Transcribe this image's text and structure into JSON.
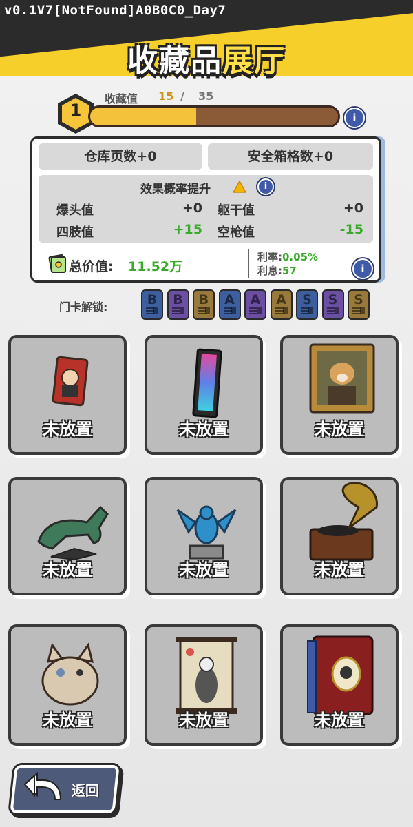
{
  "version": "v0.1V7[NotFound]A0B0C0_Day7",
  "title_part1": "收藏品",
  "title_part2": "展厅",
  "collection": {
    "level": "1",
    "label": "收藏值",
    "current": "15",
    "separator": "/",
    "max": "35",
    "progress_fraction": 0.4286
  },
  "card": {
    "warehouse_pages": "仓库页数+0",
    "safe_slots": "安全箱格数+0",
    "effect_title": "效果概率提升",
    "stats": [
      {
        "label": "爆头值",
        "value": "+0",
        "color": "#333333"
      },
      {
        "label": "躯干值",
        "value": "+0",
        "color": "#333333"
      },
      {
        "label": "四肢值",
        "value": "+15",
        "color": "#3aaa2b"
      },
      {
        "label": "空枪值",
        "value": "-15",
        "color": "#3aaa2b"
      }
    ],
    "total_label": "总价值:",
    "total_value": "11.52万",
    "rate_label": "利率:",
    "rate_value": "0.05%",
    "interest_label": "利息:",
    "interest_value": "57"
  },
  "unlock_label": "门卡解锁:",
  "keycards": [
    {
      "letter": "B",
      "color": "#3d5f9e"
    },
    {
      "letter": "B",
      "color": "#6a4fa3"
    },
    {
      "letter": "B",
      "color": "#9a7a3b"
    },
    {
      "letter": "A",
      "color": "#3d5f9e"
    },
    {
      "letter": "A",
      "color": "#6a4fa3"
    },
    {
      "letter": "A",
      "color": "#9a7a3b"
    },
    {
      "letter": "S",
      "color": "#3d5f9e"
    },
    {
      "letter": "S",
      "color": "#6a4fa3"
    },
    {
      "letter": "S",
      "color": "#9a7a3b"
    }
  ],
  "slots": [
    {
      "label": "未放置",
      "item": "playing-card-icon"
    },
    {
      "label": "未放置",
      "item": "memory-stick-icon"
    },
    {
      "label": "未放置",
      "item": "dog-portrait-icon"
    },
    {
      "label": "未放置",
      "item": "bronze-horse-icon"
    },
    {
      "label": "未放置",
      "item": "bird-statue-icon"
    },
    {
      "label": "未放置",
      "item": "gramophone-icon"
    },
    {
      "label": "未放置",
      "item": "cat-plush-icon"
    },
    {
      "label": "未放置",
      "item": "scroll-painting-icon"
    },
    {
      "label": "未放置",
      "item": "red-book-icon"
    }
  ],
  "back_label": "返回"
}
